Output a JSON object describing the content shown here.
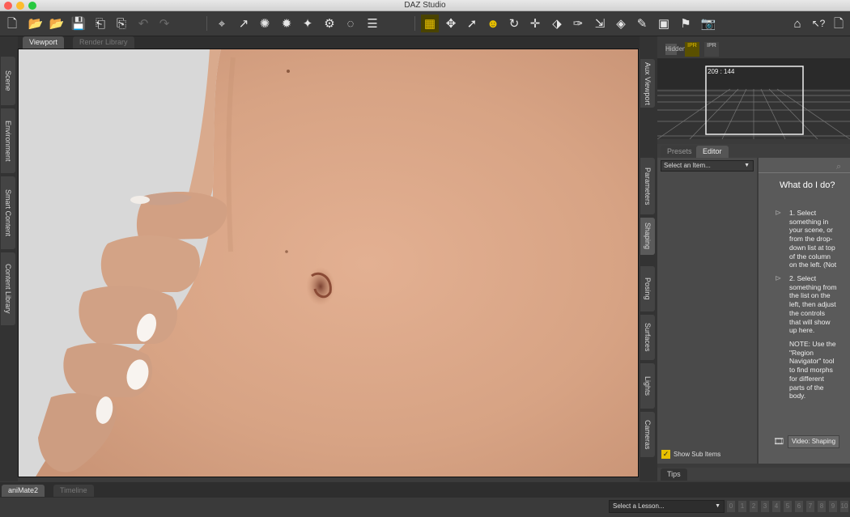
{
  "window": {
    "title": "DAZ Studio"
  },
  "viewport_tabs": [
    "Viewport",
    "Render Library"
  ],
  "left_tabs": [
    "Scene",
    "Environment",
    "Smart Content",
    "Content Library"
  ],
  "right_tabs": [
    "Aux Viewport",
    "Parameters",
    "Shaping",
    "Posing",
    "Surfaces",
    "Lights",
    "Cameras"
  ],
  "aux": {
    "dims": "209 : 144",
    "draw_modes": [
      "Hidden",
      "IPR",
      "IPR"
    ]
  },
  "panel": {
    "tabs": [
      "Presets",
      "Editor"
    ],
    "select": "Select an Item...",
    "show_sub_items": "Show Sub Items",
    "help_title": "What do I do?",
    "step1": [
      "1. Select",
      "something in",
      "your scene, or",
      "from the drop-",
      "down list at top",
      "of the column",
      "on the left. (Not"
    ],
    "step2": [
      "2. Select",
      "something from",
      "the list on the",
      "left, then adjust",
      "the controls",
      "that will show",
      "up here."
    ],
    "note": [
      "NOTE: Use the",
      "\"Region",
      "Navigator\" tool",
      "to find morphs",
      "for different",
      "parts of the",
      "body."
    ],
    "video_button": "Video: Shaping",
    "tips": "Tips"
  },
  "bottom_tabs": [
    "aniMate2",
    "Timeline"
  ],
  "lesson": {
    "placeholder": "Select a Lesson...",
    "steps": [
      "0",
      "1",
      "2",
      "3",
      "4",
      "5",
      "6",
      "7",
      "8",
      "9",
      "10"
    ]
  },
  "colors": {
    "accent": "#e8c000",
    "panel": "#3a3a3a",
    "skin": "#d9a98a"
  }
}
